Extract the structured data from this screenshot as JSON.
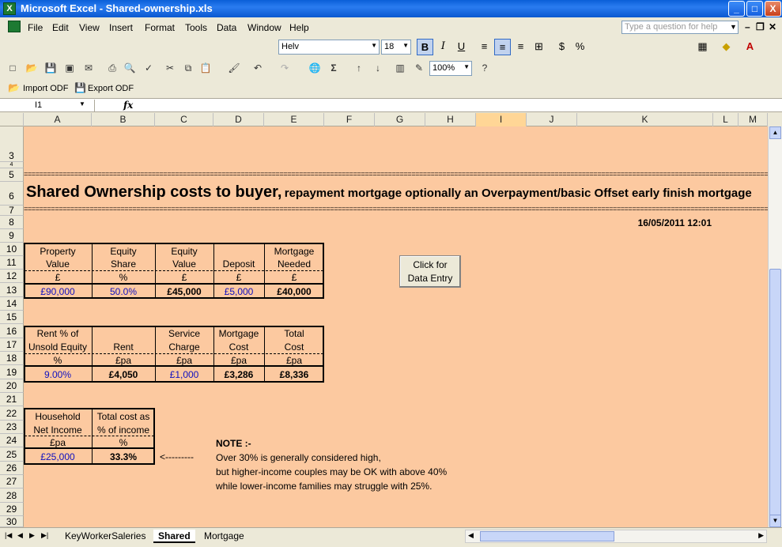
{
  "window": {
    "title": "Microsoft Excel - Shared-ownership.xls",
    "minimize": "_",
    "maximize": "□",
    "close": "X"
  },
  "menu": {
    "items": [
      "File",
      "Edit",
      "View",
      "Insert",
      "Format",
      "Tools",
      "Data",
      "Window",
      "Help"
    ],
    "ask_placeholder": "Type a question for help"
  },
  "formatting": {
    "font": "Helv",
    "size": "18",
    "bold": "B",
    "italic": "I",
    "underline": "U",
    "percent": "%"
  },
  "standard": {
    "zoom": "100%",
    "sigma": "Σ"
  },
  "odf": {
    "import_label": "Import ODF",
    "export_label": "Export ODF"
  },
  "formula_bar": {
    "name_box": "I1",
    "fx": "fx"
  },
  "columns": [
    "A",
    "B",
    "C",
    "D",
    "E",
    "F",
    "G",
    "H",
    "I",
    "J",
    "K",
    "L",
    "M"
  ],
  "rows": [
    "3",
    "4",
    "5",
    "6",
    "7",
    "8",
    "9",
    "10",
    "11",
    "12",
    "13",
    "14",
    "15",
    "16",
    "17",
    "18",
    "19",
    "20",
    "21",
    "22",
    "23",
    "24",
    "25",
    "26",
    "27",
    "28",
    "29",
    "30"
  ],
  "sheet": {
    "title_main": "Shared Ownership costs to buyer,",
    "title_rest": "repayment mortgage optionally an Overpayment/basic Offset early finish mortgage",
    "separator": "==========================================================================================================================================================================================================================",
    "datetime": "16/05/2011 12:01",
    "table1": {
      "headers": [
        [
          "Property",
          "Value"
        ],
        [
          "Equity",
          "Share"
        ],
        [
          "Equity",
          "Value"
        ],
        [
          "",
          "Deposit"
        ],
        [
          "Mortgage",
          "Needed"
        ]
      ],
      "units": [
        "£",
        "%",
        "£",
        "£",
        "£"
      ],
      "values": [
        "£90,000",
        "50.0%",
        "£45,000",
        "£5,000",
        "£40,000"
      ]
    },
    "table2": {
      "headers": [
        [
          "Rent % of",
          "Unsold Equity"
        ],
        [
          "",
          "Rent"
        ],
        [
          "Service",
          "Charge"
        ],
        [
          "Mortgage",
          "Cost"
        ],
        [
          "Total",
          "Cost"
        ]
      ],
      "units": [
        "%",
        "£pa",
        "£pa",
        "£pa",
        "£pa"
      ],
      "values": [
        "9.00%",
        "£4,050",
        "£1,000",
        "£3,286",
        "£8,336"
      ]
    },
    "table3": {
      "headers": [
        [
          "Household",
          "Net Income"
        ],
        [
          "Total cost as",
          "% of income"
        ]
      ],
      "units": [
        "£pa",
        "%"
      ],
      "values": [
        "£25,000",
        "33.3%"
      ]
    },
    "arrow_text": "<---------",
    "note_title": "NOTE :-",
    "note_lines": [
      "Over 30% is generally considered high,",
      "but higher-income couples may be OK with above 40%",
      "while lower-income families may struggle with 25%."
    ],
    "button_label": [
      "Click for",
      "Data Entry"
    ]
  },
  "tabs": [
    "KeyWorkerSaleries",
    "Shared",
    "Mortgage"
  ]
}
